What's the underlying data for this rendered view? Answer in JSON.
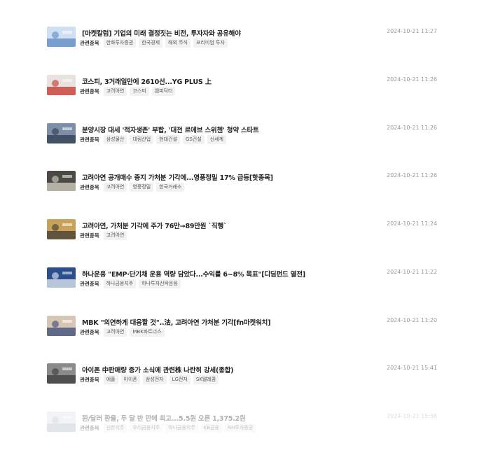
{
  "list_label": "관련종목",
  "items": [
    {
      "headline": "[마켓칼럼] 기업의 미래 결정짓는 비전, 투자자와 공유해야",
      "time": "2024-10-21 11:27",
      "tags": [
        "한화투자증권",
        "한국경제",
        "해외 주식",
        "프리미엄 투자"
      ],
      "thumb_colors": [
        "#cfe0f2",
        "#5a88c2"
      ]
    },
    {
      "headline": "코스피, 3거래일만에 2610선...YG PLUS 上",
      "time": "2024-10-21 11:26",
      "tags": [
        "고려아연",
        "코스피",
        "엠피닥터"
      ],
      "thumb_colors": [
        "#e7e2de",
        "#c8312b"
      ]
    },
    {
      "headline": "분양시장 대세 '적자생존' 부합, '대전 르에브 스위첸' 청약 스타트",
      "time": "2024-10-21 11:26",
      "tags": [
        "삼성물산",
        "대림산업",
        "현대건설",
        "GS건설",
        "신세계"
      ],
      "thumb_colors": [
        "#7d8fa8",
        "#2f3c50"
      ]
    },
    {
      "headline": "고려아연 공개매수 중지 가처분 기각에...영풍정밀 17% 급등[핫종목]",
      "time": "2024-10-21 11:26",
      "tags": [
        "고려아연",
        "영풍정밀",
        "한국거래소"
      ],
      "thumb_colors": [
        "#4b4a44",
        "#d8d3c4"
      ]
    },
    {
      "headline": "고려아연, 가처분 기각에 주가 76만→89만원 `직행`",
      "time": "2024-10-21 11:24",
      "tags": [
        "고려아연"
      ],
      "thumb_colors": [
        "#c9a25a",
        "#3d3a34"
      ]
    },
    {
      "headline": "하나운용 \"EMP·단기채 운용 역량 담았다...수익률 6~8% 목표\"[디딤펀드 열전]",
      "time": "2024-10-21 11:22",
      "tags": [
        "하나금융지주",
        "하나투자신탁운용"
      ],
      "thumb_colors": [
        "#2a4f8c",
        "#e8ecf3"
      ]
    },
    {
      "headline": "MBK \"의연하게 대응할 것\"..法, 고려아연 가처분 기각[fn마켓워치]",
      "time": "2024-10-21 11:20",
      "tags": [
        "고려아연",
        "MBK파트너스"
      ],
      "thumb_colors": [
        "#d8c6b5",
        "#3a4a7a"
      ]
    },
    {
      "headline": "아이폰 中판매량 증가 소식에 관련株 나란히 강세(종합)",
      "time": "2024-10-21 15:41",
      "tags": [
        "애플",
        "아이폰",
        "삼성전자",
        "LG전자",
        "SK텔레콤"
      ],
      "thumb_colors": [
        "#8a8a8a",
        "#3b3b3b"
      ]
    },
    {
      "headline": "원/달러 환율, 두 달 반 만에 최고...5.5원 오른 1,375.2원",
      "time": "2024-10-21 15:38",
      "tags": [
        "신한지주",
        "우리금융지주",
        "하나금융지주",
        "KB금융",
        "NH투자증권"
      ],
      "thumb_colors": [
        "#d9dde3",
        "#9aa6b5"
      ]
    }
  ]
}
